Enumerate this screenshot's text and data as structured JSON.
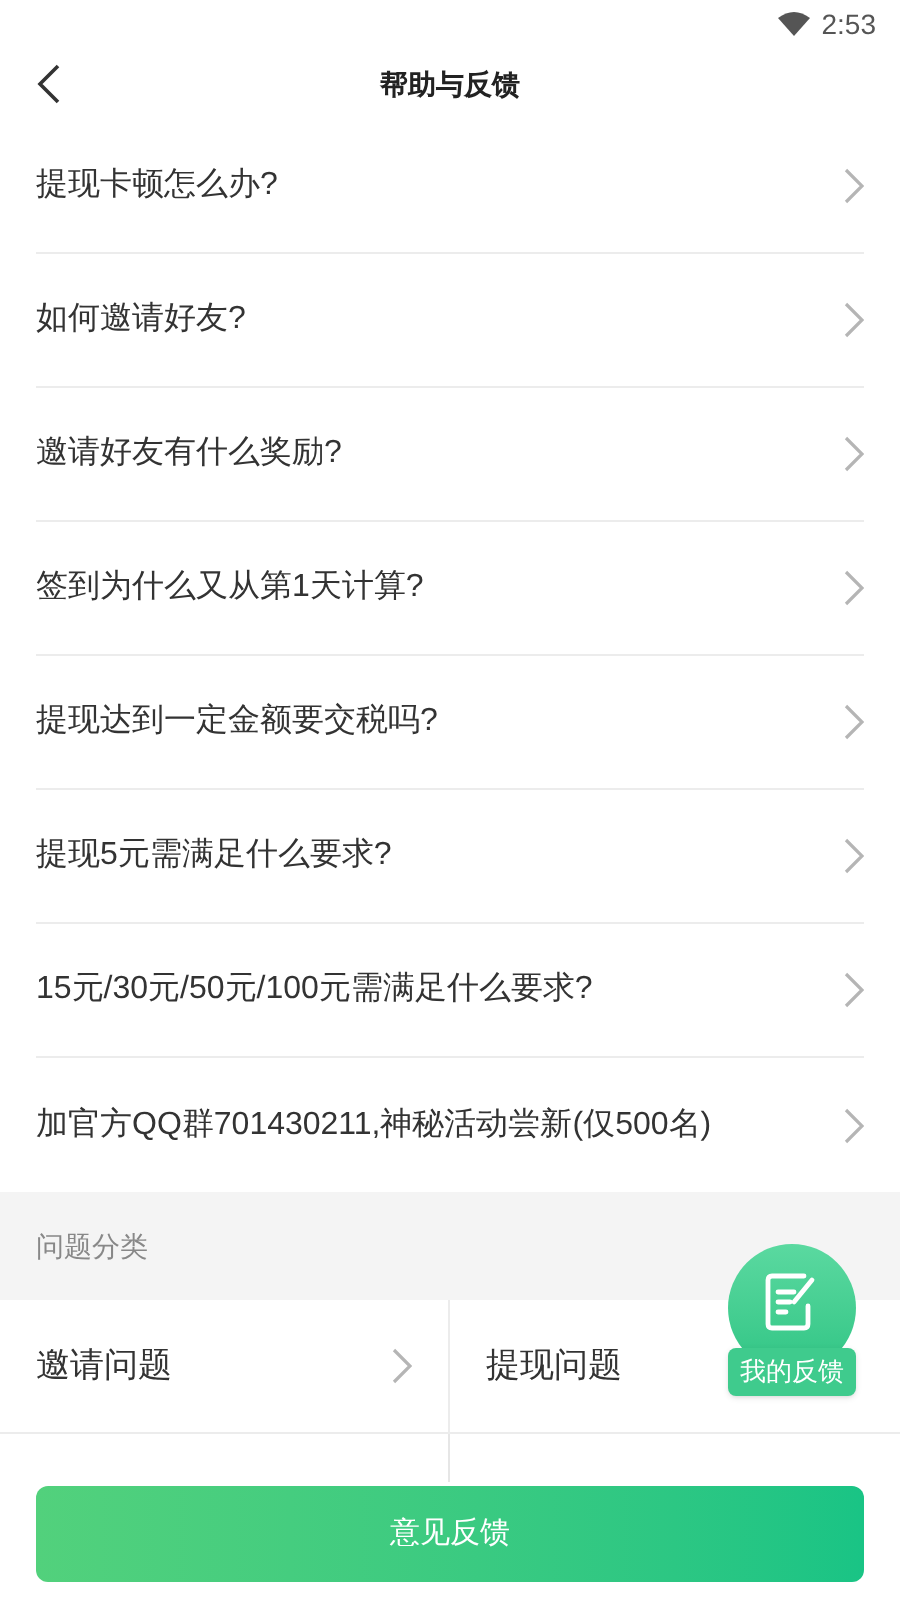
{
  "status_bar": {
    "time": "2:53"
  },
  "header": {
    "title": "帮助与反馈"
  },
  "questions": [
    {
      "label": "提现卡顿怎么办?"
    },
    {
      "label": "如何邀请好友?"
    },
    {
      "label": "邀请好友有什么奖励?"
    },
    {
      "label": "签到为什么又从第1天计算?"
    },
    {
      "label": "提现达到一定金额要交税吗?"
    },
    {
      "label": "提现5元需满足什么要求?"
    },
    {
      "label": "15元/30元/50元/100元需满足什么要求?"
    },
    {
      "label": "加官方QQ群701430211,神秘活动尝新(仅500名)"
    }
  ],
  "section": {
    "title": "问题分类"
  },
  "categories": [
    {
      "label": "邀请问题",
      "arrow": true
    },
    {
      "label": "提现问题",
      "arrow": false
    }
  ],
  "floating_button": {
    "label": "我的反馈"
  },
  "feedback_button": {
    "label": "意见反馈"
  }
}
